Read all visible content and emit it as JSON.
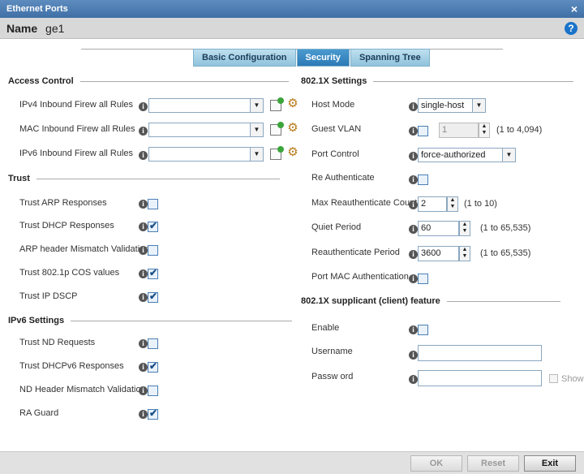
{
  "window": {
    "title": "Ethernet Ports",
    "close": "×"
  },
  "name_bar": {
    "label": "Name",
    "value": "ge1",
    "help": "?"
  },
  "tabs": [
    {
      "label": "Basic Configuration",
      "active": false
    },
    {
      "label": "Security",
      "active": true
    },
    {
      "label": "Spanning Tree",
      "active": false
    }
  ],
  "access_control": {
    "heading": "Access Control",
    "rows": [
      {
        "label": "IPv4 Inbound Firew all Rules",
        "value": ""
      },
      {
        "label": "MAC Inbound Firew all Rules",
        "value": ""
      },
      {
        "label": "IPv6 Inbound Firew all Rules",
        "value": ""
      }
    ]
  },
  "trust": {
    "heading": "Trust",
    "rows": [
      {
        "label": "Trust ARP Responses",
        "checked": false
      },
      {
        "label": "Trust DHCP Responses",
        "checked": true
      },
      {
        "label": "ARP header Mismatch Validation",
        "checked": false
      },
      {
        "label": "Trust 802.1p COS values",
        "checked": true
      },
      {
        "label": "Trust IP DSCP",
        "checked": true
      }
    ]
  },
  "ipv6_settings": {
    "heading": "IPv6 Settings",
    "rows": [
      {
        "label": "Trust ND Requests",
        "checked": false
      },
      {
        "label": "Trust DHCPv6 Responses",
        "checked": true
      },
      {
        "label": "ND Header Mismatch Validation",
        "checked": false
      },
      {
        "label": "RA Guard",
        "checked": true
      }
    ]
  },
  "dot1x": {
    "heading": "802.1X Settings",
    "host_mode": {
      "label": "Host Mode",
      "value": "single-host"
    },
    "guest_vlan": {
      "label": "Guest VLAN",
      "value": "1",
      "range": "(1 to 4,094)",
      "checked": false
    },
    "port_control": {
      "label": "Port Control",
      "value": "force-authorized"
    },
    "re_authenticate": {
      "label": "Re Authenticate",
      "checked": false
    },
    "max_reauth": {
      "label": "Max Reauthenticate Count",
      "value": "2",
      "range": "(1 to 10)"
    },
    "quiet_period": {
      "label": "Quiet Period",
      "value": "60",
      "range": "(1 to 65,535)"
    },
    "reauth_period": {
      "label": "Reauthenticate Period",
      "value": "3600",
      "range": "(1 to 65,535)"
    },
    "port_mac_auth": {
      "label": "Port MAC Authentication",
      "checked": false
    }
  },
  "supplicant": {
    "heading": "802.1X supplicant (client) feature",
    "enable": {
      "label": "Enable",
      "checked": false
    },
    "username": {
      "label": "Username",
      "value": ""
    },
    "password": {
      "label": "Passw ord",
      "value": "",
      "show_label": "Show"
    }
  },
  "footer": {
    "ok": "OK",
    "reset": "Reset",
    "exit": "Exit"
  }
}
